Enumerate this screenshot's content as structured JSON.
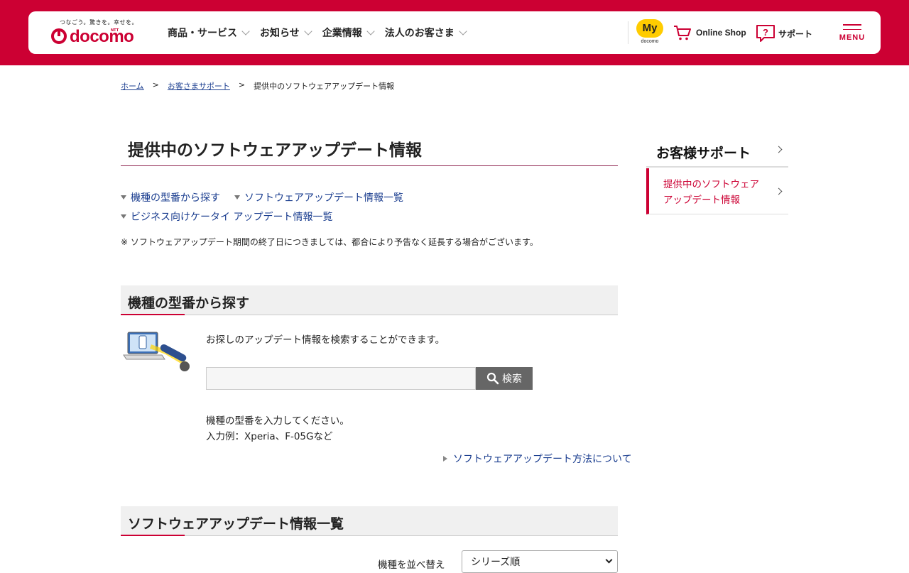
{
  "header": {
    "logo_tagline": "つなごう。驚きを。幸せを。",
    "logo_ntt": "NTT",
    "logo_text": "docomo",
    "nav": [
      {
        "label": "商品・サービス"
      },
      {
        "label": "お知らせ"
      },
      {
        "label": "企業情報"
      },
      {
        "label": "法人のお客さま"
      }
    ],
    "my_badge": "My",
    "my_sub": "docomo",
    "online_shop": "Online Shop",
    "support": "サポート",
    "menu": "MENU",
    "colors": {
      "brand": "#cc0033",
      "my_badge": "#ffcc00"
    }
  },
  "breadcrumb": [
    {
      "label": "ホーム"
    },
    {
      "label": "お客さまサポート"
    },
    {
      "label": "提供中のソフトウェアアップデート情報"
    }
  ],
  "main": {
    "title": "提供中のソフトウェアアップデート情報",
    "anchors": [
      {
        "label": "機種の型番から探す"
      },
      {
        "label": "ソフトウェアアップデート情報一覧"
      },
      {
        "label": "ビジネス向けケータイ アップデート情報一覧"
      }
    ],
    "note": "※ ソフトウェアアップデート期間の終了日につきましては、都合により予告なく延長する場合がございます。",
    "search_section": {
      "heading": "機種の型番から探す",
      "description": "お探しのアップデート情報を検索することができます。",
      "input_value": "",
      "search_button": "検索",
      "help_line1": "機種の型番を入力してください。",
      "help_line2": "入力例：Xperia、F-05Gなど",
      "howto_link": "ソフトウェアアップデート方法について"
    },
    "list_section": {
      "heading": "ソフトウェアアップデート情報一覧",
      "sort_label": "機種を並べ替え",
      "sort_selected": "シリーズ順"
    }
  },
  "side": {
    "title": "お客様サポート",
    "items": [
      {
        "label": "提供中のソフトウェアアップデート情報"
      }
    ]
  }
}
